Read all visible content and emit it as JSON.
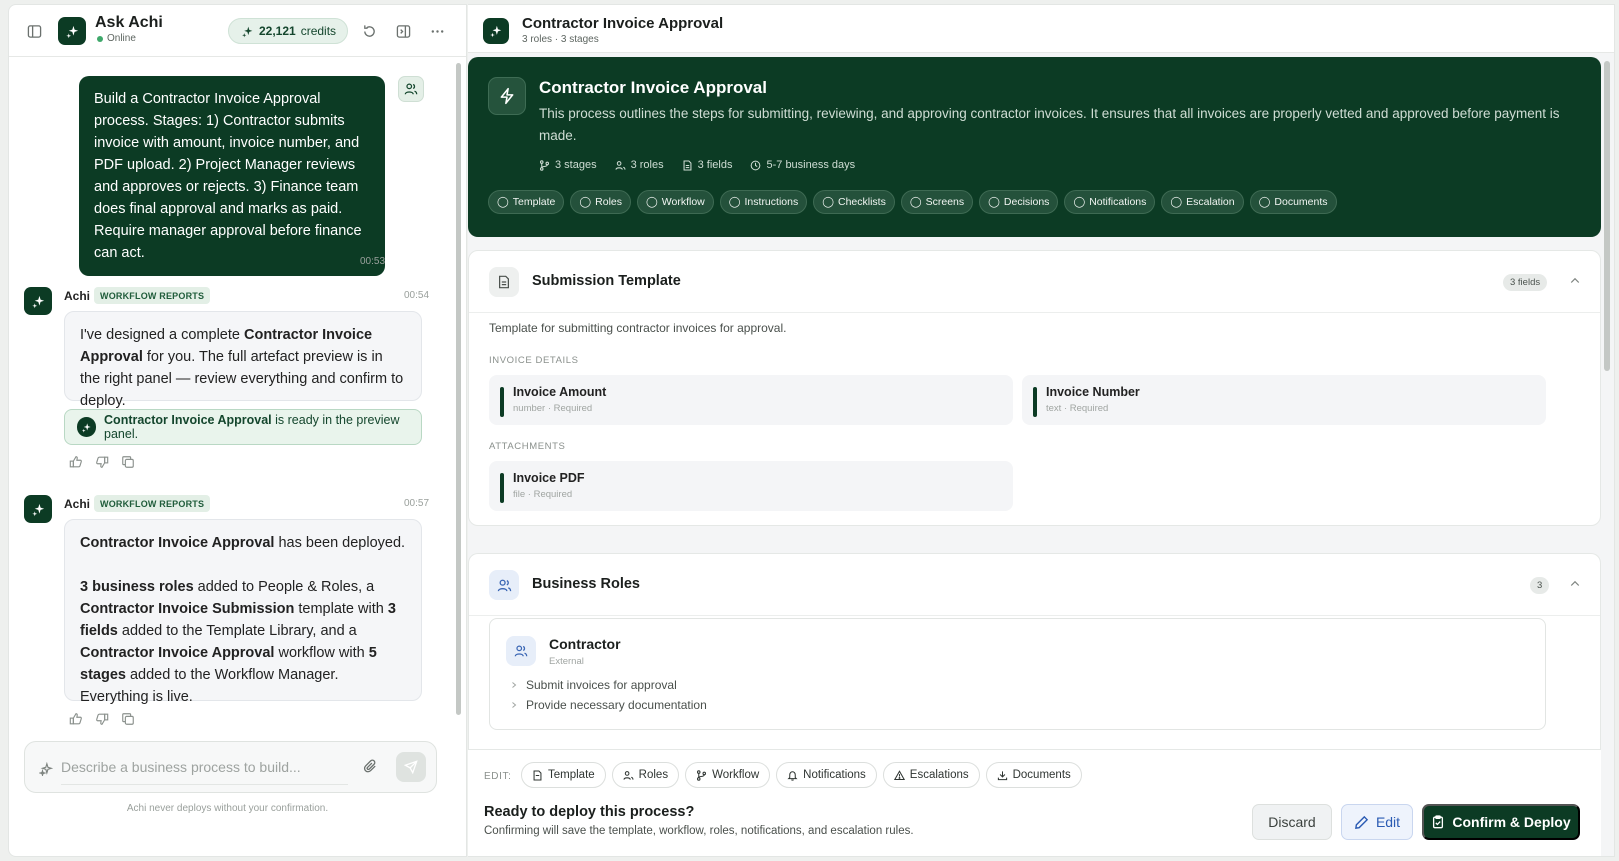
{
  "left": {
    "app_title": "Ask Achi",
    "status": "Online",
    "credits_value": "22,121",
    "credits_label": "credits"
  },
  "chat": {
    "user_message": {
      "text": "Build a Contractor Invoice Approval process. Stages: 1) Contractor submits invoice with amount, invoice number, and PDF upload. 2) Project Manager reviews and approves or rejects. 3) Finance team does final approval and marks as paid. Require manager approval before finance can act.",
      "time": "00:53"
    },
    "bot_message_1": {
      "name": "Achi",
      "badge": "WORKFLOW REPORTS",
      "time": "00:54",
      "t1": "I've designed a complete ",
      "b1": "Contractor Invoice Approval",
      "t2": " for you. The full artefact preview is in the right panel — review everything and confirm to deploy."
    },
    "ready_note": {
      "bold": "Contractor Invoice Approval",
      "text": " is ready in the preview panel."
    },
    "bot_message_2": {
      "name": "Achi",
      "badge": "WORKFLOW REPORTS",
      "time": "00:57",
      "p1_bold": "Contractor Invoice Approval",
      "p1_text": " has been deployed.",
      "b1": "3 business roles",
      "t1": " added to People & Roles, a ",
      "b2": "Contractor Invoice Submission",
      "t2": " template with ",
      "b3": "3 fields",
      "t3": " added to the Template Library, and a ",
      "b4": "Contractor Invoice Approval",
      "t4": " workflow with ",
      "b5": "5 stages",
      "t5": " added to the Workflow Manager. Everything is live."
    }
  },
  "composer": {
    "placeholder": "Describe a business process to build...",
    "disclaimer": "Achi never deploys without your confirmation."
  },
  "right": {
    "title": "Contractor Invoice Approval",
    "subtitle": "3 roles · 3 stages",
    "hero": {
      "title": "Contractor Invoice Approval",
      "description": "This process outlines the steps for submitting, reviewing, and approving contractor invoices. It ensures that all invoices are properly vetted and approved before payment is made.",
      "meta": [
        "3 stages",
        "3 roles",
        "3 fields",
        "5-7 business days"
      ],
      "chips": [
        "Template",
        "Roles",
        "Workflow",
        "Instructions",
        "Checklists",
        "Screens",
        "Decisions",
        "Notifications",
        "Escalation",
        "Documents"
      ]
    },
    "template_card": {
      "title": "Submission Template",
      "count": "3 fields",
      "description": "Template for submitting contractor invoices for approval.",
      "section1": "INVOICE DETAILS",
      "section2": "ATTACHMENTS",
      "fields": [
        {
          "name": "Invoice Amount",
          "meta": "number · Required"
        },
        {
          "name": "Invoice Number",
          "meta": "text · Required"
        },
        {
          "name": "Invoice PDF",
          "meta": "file · Required"
        }
      ]
    },
    "roles_card": {
      "title": "Business Roles",
      "count": "3",
      "role_name": "Contractor",
      "role_type": "External",
      "responsibilities": [
        "Submit invoices for approval",
        "Provide necessary documentation"
      ]
    },
    "bottom": {
      "edit_label": "EDIT:",
      "edit_chips": [
        "Template",
        "Roles",
        "Workflow",
        "Notifications",
        "Escalations",
        "Documents"
      ],
      "question": "Ready to deploy this process?",
      "sub": "Confirming will save the template, workflow, roles, notifications, and escalation rules.",
      "discard": "Discard",
      "edit": "Edit",
      "deploy": "Confirm & Deploy"
    }
  },
  "colors": {
    "brand": "#0c3b24",
    "accent_blue": "#2b5bb3"
  }
}
